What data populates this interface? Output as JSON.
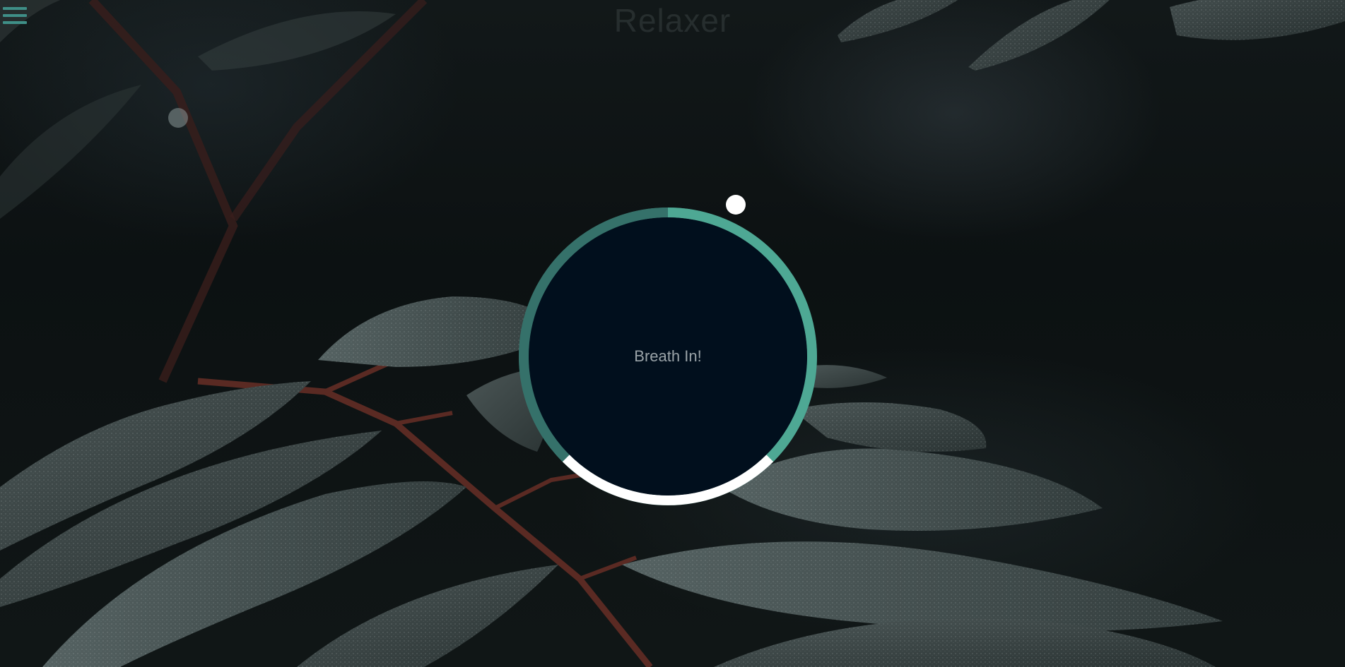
{
  "app": {
    "title": "Relaxer"
  },
  "menu": {
    "icon": "hamburger-menu-icon"
  },
  "breather": {
    "instruction": "Breath In!",
    "phases": [
      {
        "name": "breathe-in",
        "color": "#4ea894"
      },
      {
        "name": "hold",
        "color": "#ffffff"
      },
      {
        "name": "breathe-out",
        "color": "#3a7a70"
      }
    ],
    "inner_color": "#010f1d",
    "pointer_color": "#ffffff"
  },
  "colors": {
    "accent": "#3f8f87",
    "ring_in": "#4ea894",
    "ring_hold": "#ffffff",
    "ring_out": "#3a7a70"
  }
}
